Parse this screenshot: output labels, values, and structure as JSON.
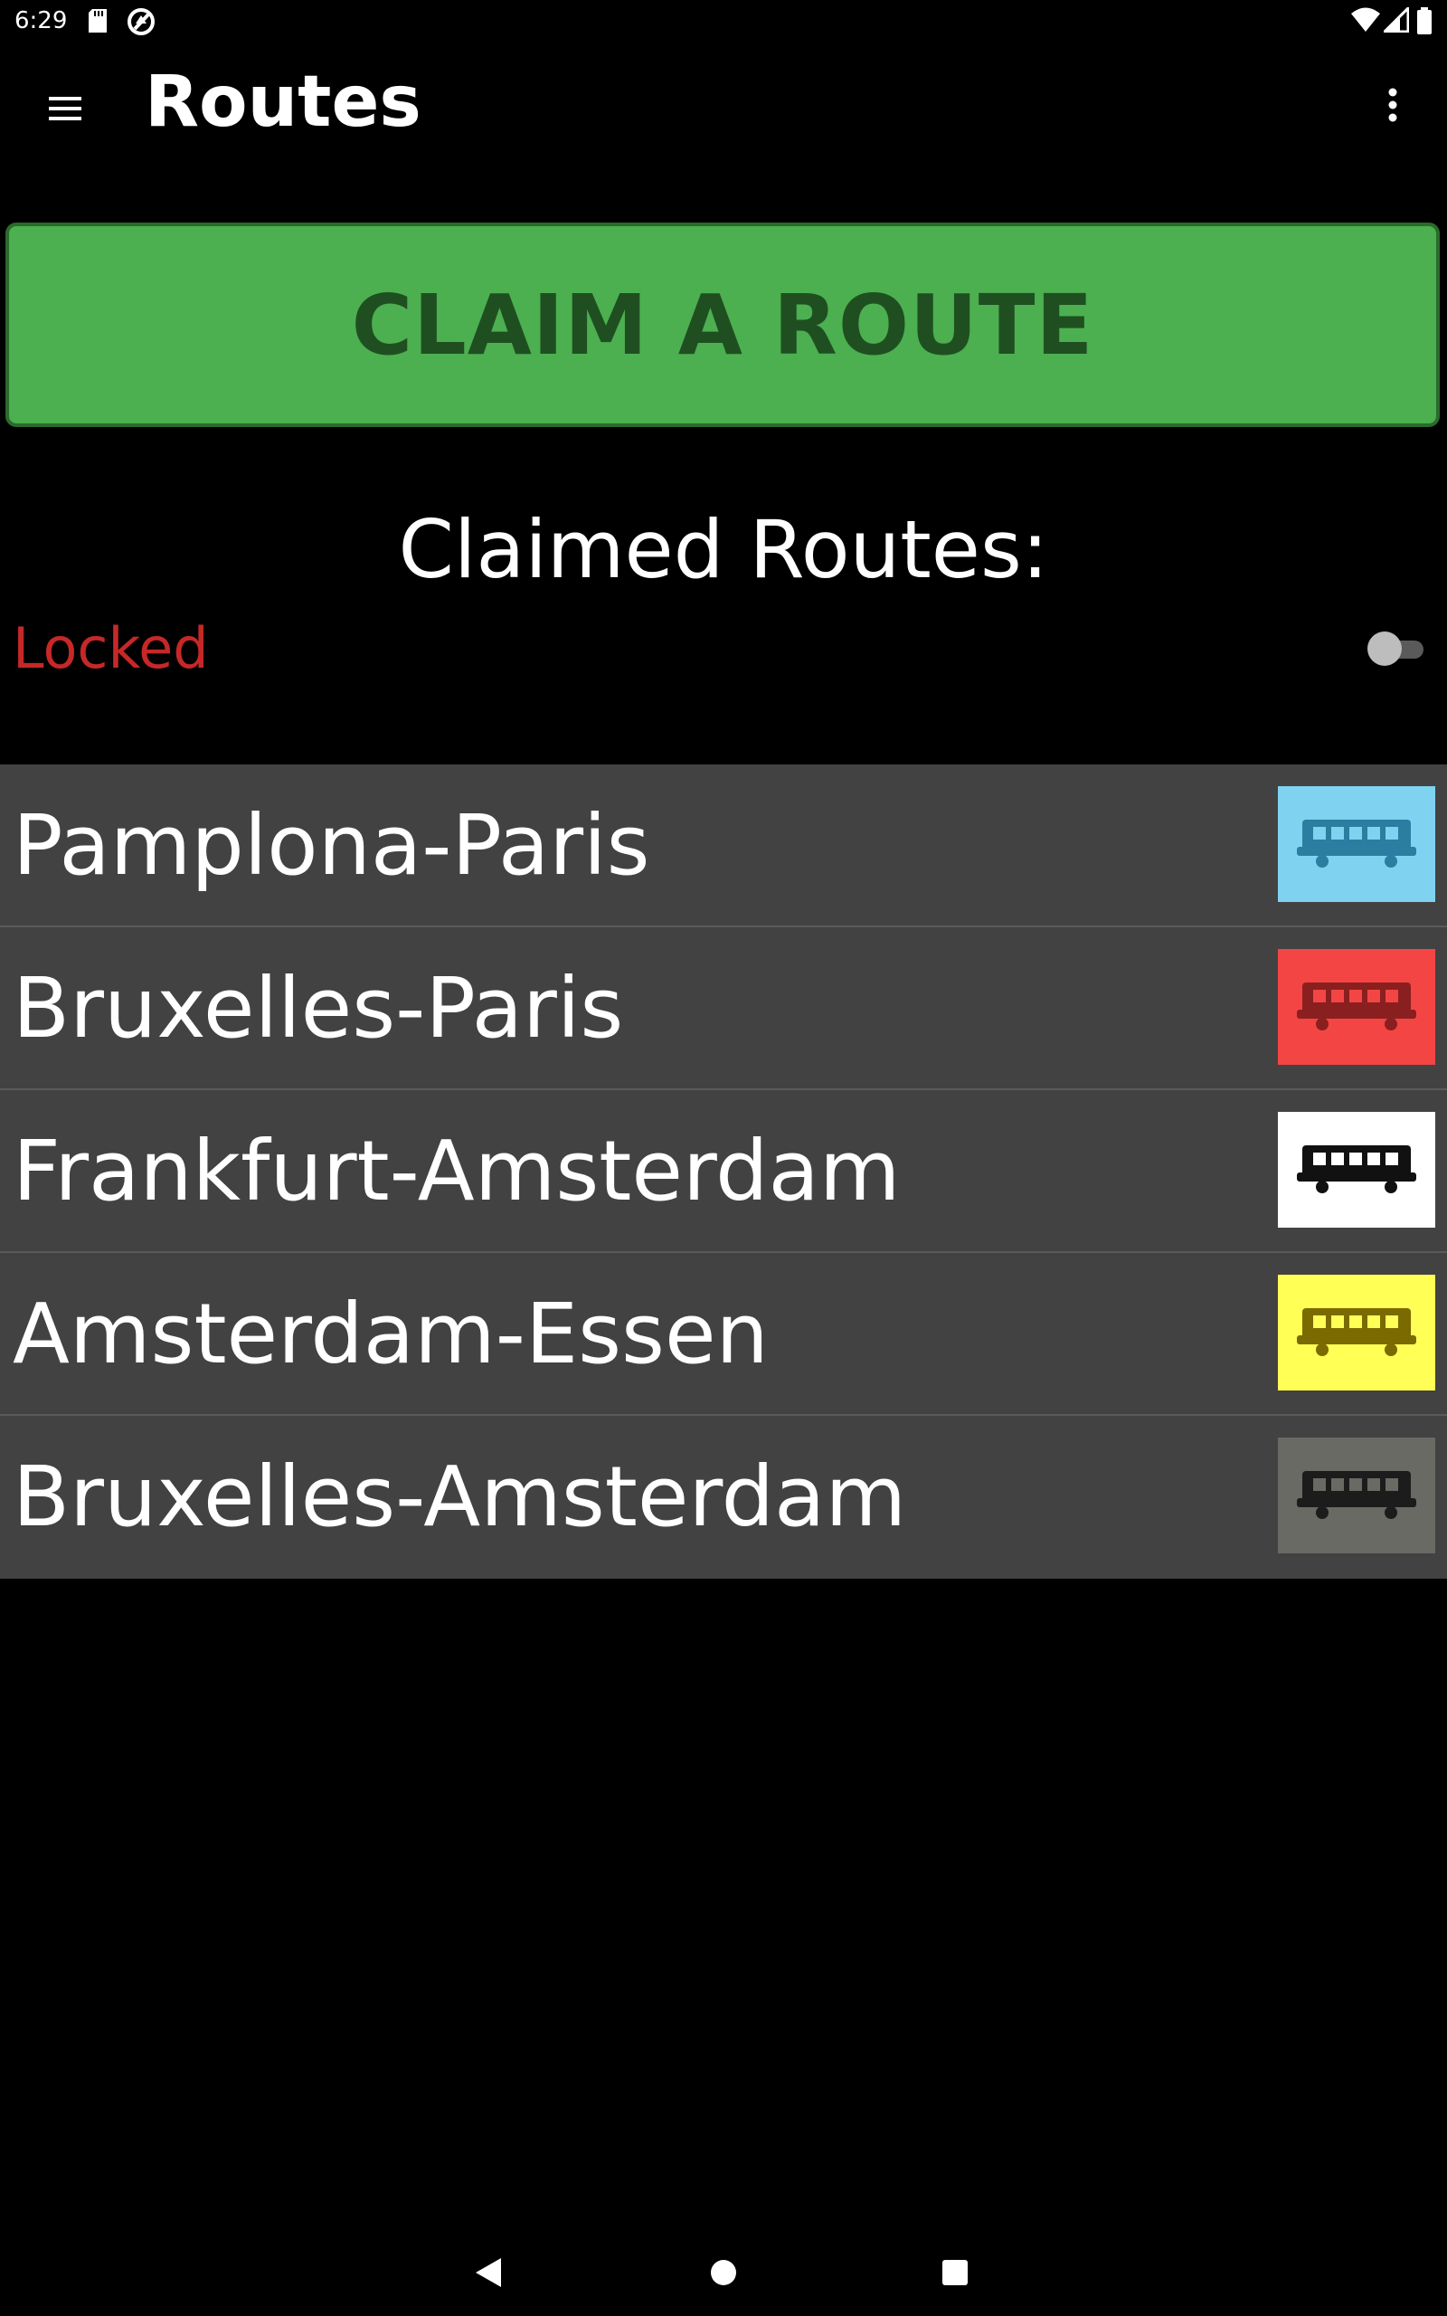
{
  "status_bar": {
    "time": "6:29",
    "icons": [
      "sd-card-icon",
      "sync-icon",
      "wifi-icon",
      "signal-icon",
      "battery-icon"
    ]
  },
  "app_bar": {
    "title": "Routes",
    "menu_icon": "hamburger-menu-icon",
    "overflow_icon": "more-vert-icon"
  },
  "claim_button": {
    "label": "CLAIM A ROUTE",
    "color": "#4caf50"
  },
  "claimed_heading": "Claimed Routes:",
  "lock": {
    "label": "Locked",
    "color": "#c62828",
    "toggle_on": false
  },
  "routes": [
    {
      "name": "Pamplona-Paris",
      "color": "#7fd3f0",
      "icon_color": "#2b7ea0",
      "icon": "train-car-icon"
    },
    {
      "name": "Bruxelles-Paris",
      "color": "#f44545",
      "icon_color": "#8a1f1f",
      "icon": "train-car-icon"
    },
    {
      "name": "Frankfurt-Amsterdam",
      "color": "#ffffff",
      "icon_color": "#111111",
      "icon": "train-car-icon"
    },
    {
      "name": "Amsterdam-Essen",
      "color": "#ffff55",
      "icon_color": "#7a6a00",
      "icon": "train-car-icon"
    },
    {
      "name": "Bruxelles-Amsterdam",
      "color": "#696a64",
      "icon_color": "#1c1c1c",
      "icon": "train-car-icon"
    }
  ],
  "nav_bar": {
    "icons": [
      "back-icon",
      "home-icon",
      "recents-icon"
    ]
  }
}
